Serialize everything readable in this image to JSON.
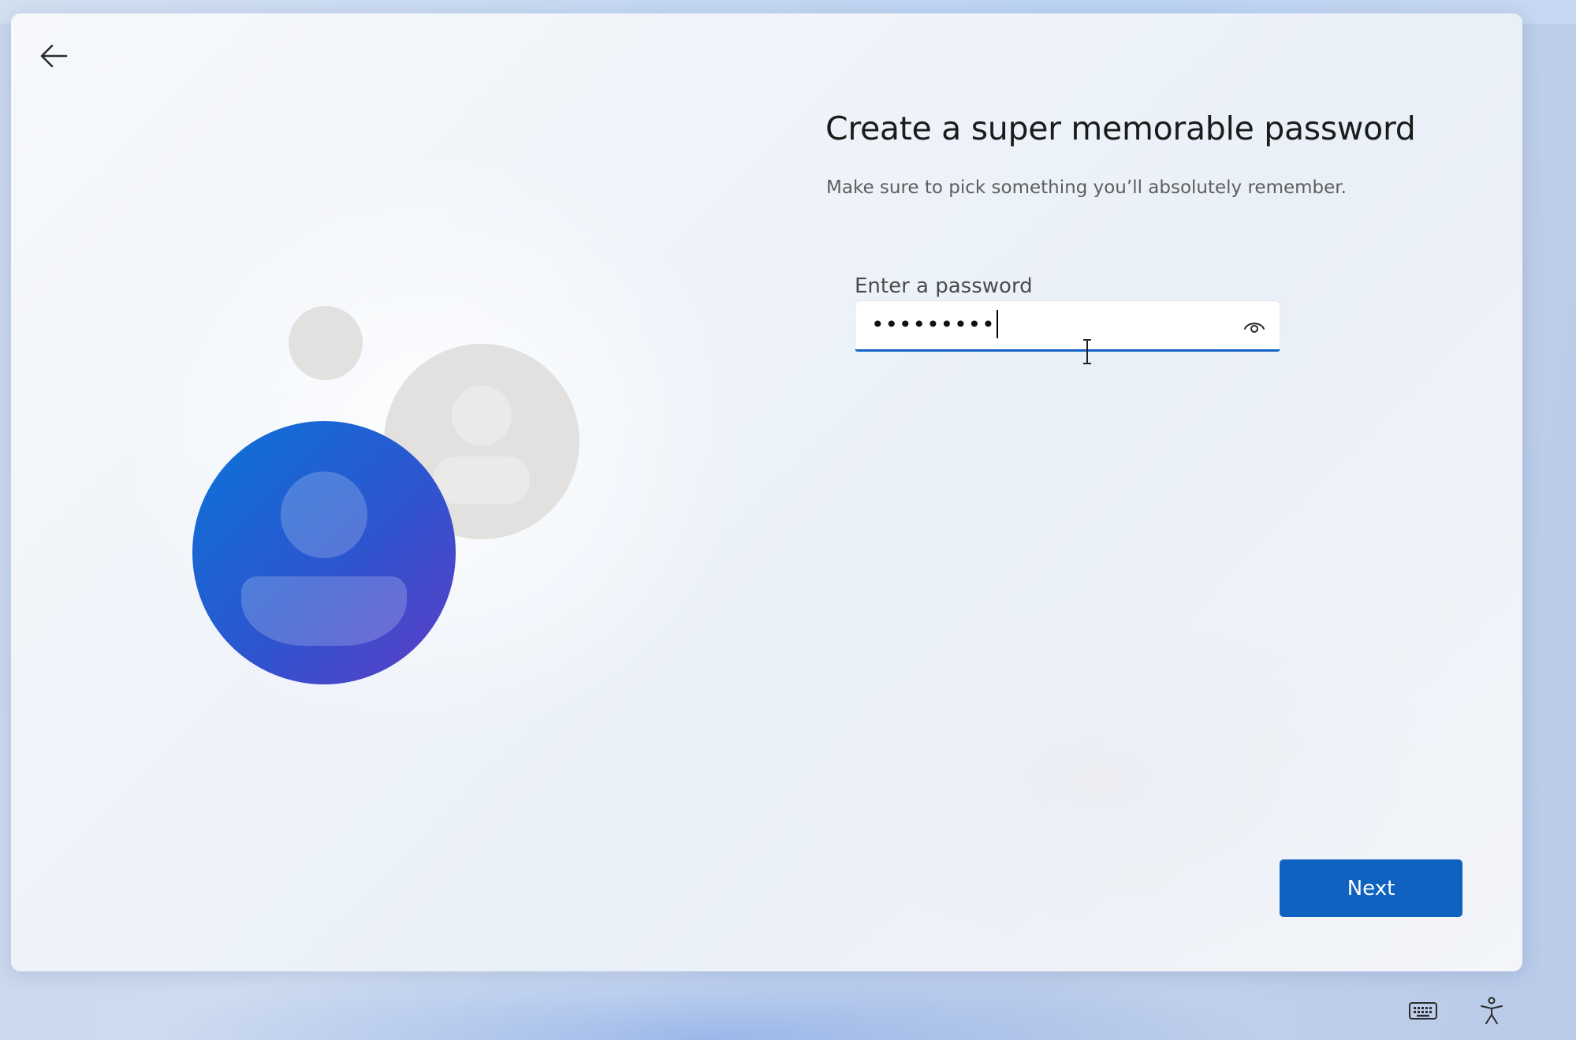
{
  "page": {
    "title": "Create a super memorable password",
    "subtitle": "Make sure to pick something you’ll absolutely remember."
  },
  "password_field": {
    "label": "Enter a password",
    "masked_value": "•••••••••",
    "reveal_icon": "eye-icon"
  },
  "buttons": {
    "next_label": "Next",
    "back_icon": "arrow-left-icon"
  },
  "system_tray": {
    "keyboard_icon": "keyboard-icon",
    "accessibility_icon": "accessibility-icon"
  },
  "colors": {
    "accent": "#0f62bf",
    "field_underline": "#1463c8",
    "avatar_primary_start": "#0a72d6",
    "avatar_primary_end": "#5a3fc8",
    "avatar_secondary": "#e2e1e0"
  }
}
